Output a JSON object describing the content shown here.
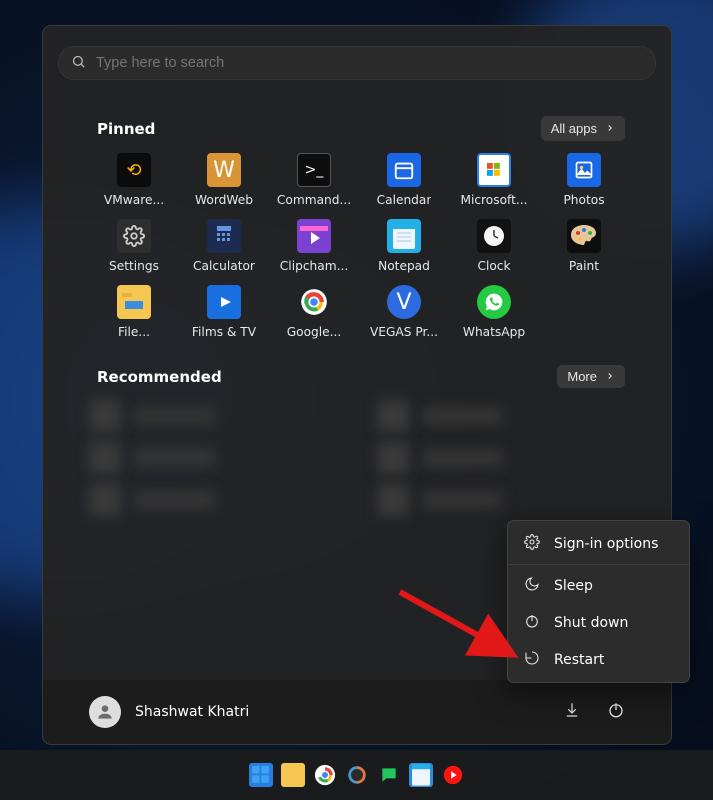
{
  "search": {
    "placeholder": "Type here to search"
  },
  "sections": {
    "pinned_title": "Pinned",
    "all_apps_label": "All apps",
    "recommended_title": "Recommended",
    "more_label": "More"
  },
  "pinned_apps": [
    {
      "label": "VMware...",
      "icon": "vmware-icon"
    },
    {
      "label": "WordWeb",
      "icon": "wordweb-icon"
    },
    {
      "label": "Command...",
      "icon": "cmd-icon"
    },
    {
      "label": "Calendar",
      "icon": "calendar-icon"
    },
    {
      "label": "Microsoft...",
      "icon": "msstore-icon"
    },
    {
      "label": "Photos",
      "icon": "photos-icon"
    },
    {
      "label": "Settings",
      "icon": "settings-icon"
    },
    {
      "label": "Calculator",
      "icon": "calculator-icon"
    },
    {
      "label": "Clipcham...",
      "icon": "clipchamp-icon"
    },
    {
      "label": "Notepad",
      "icon": "notepad-icon"
    },
    {
      "label": "Clock",
      "icon": "clock-icon"
    },
    {
      "label": "Paint",
      "icon": "paint-icon"
    },
    {
      "label": "File...",
      "icon": "fileexplorer-icon"
    },
    {
      "label": "Films & TV",
      "icon": "films-icon"
    },
    {
      "label": "Google...",
      "icon": "chrome-icon"
    },
    {
      "label": "VEGAS Pr...",
      "icon": "vegas-icon"
    },
    {
      "label": "WhatsApp",
      "icon": "whatsapp-icon"
    }
  ],
  "user": {
    "name": "Shashwat Khatri"
  },
  "power_menu": {
    "sign_in": "Sign-in options",
    "sleep": "Sleep",
    "shutdown": "Shut down",
    "restart": "Restart"
  },
  "annotation": {
    "arrow_color": "#e21717"
  },
  "taskbar_apps": [
    "start",
    "file-explorer",
    "chrome",
    "copilot",
    "whatsapp",
    "notepad",
    "youtube-music"
  ]
}
